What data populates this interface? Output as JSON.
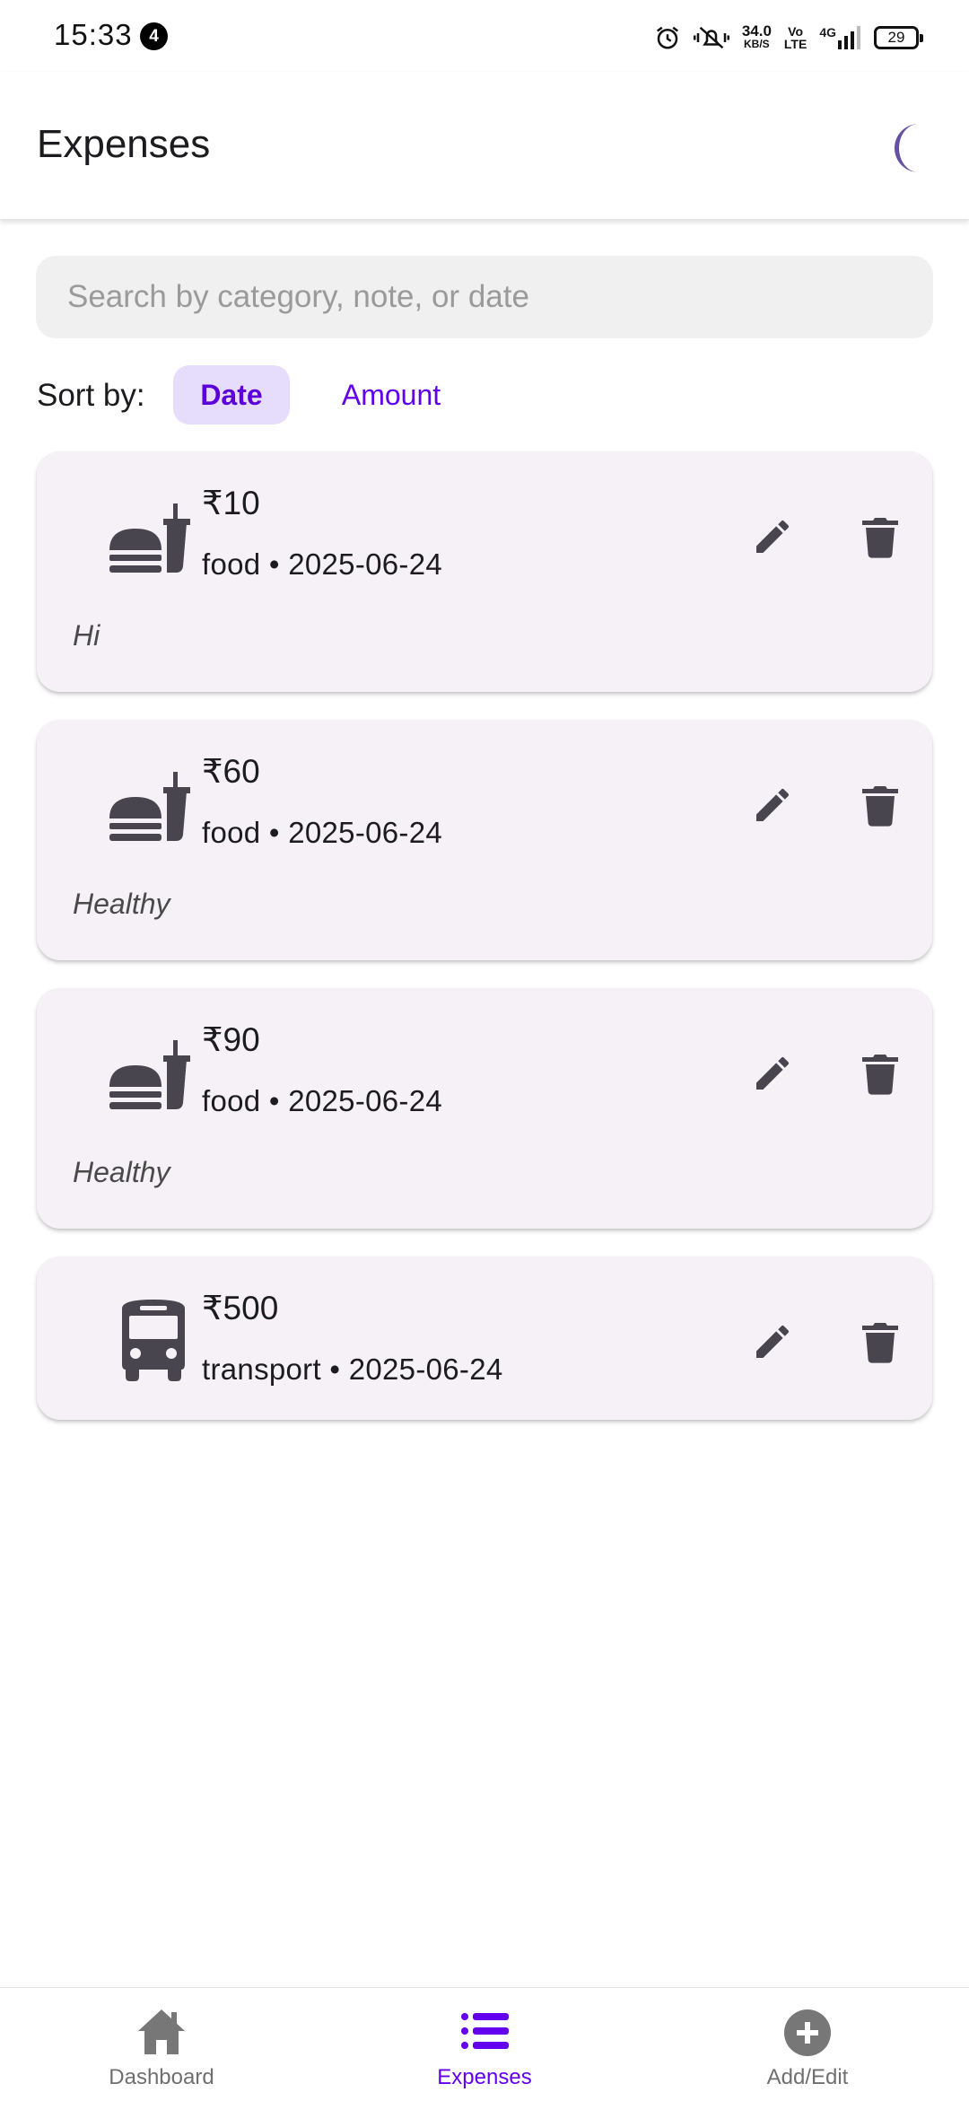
{
  "status_bar": {
    "time": "15:33",
    "notification_count": "4",
    "net_speed": "34.0",
    "net_unit": "KB/S",
    "volte_top": "Vo",
    "volte_bottom": "LTE",
    "network": "4G",
    "battery": "29"
  },
  "app_bar": {
    "title": "Expenses",
    "theme_icon": "moon-icon"
  },
  "search": {
    "placeholder": "Search by category, note, or date",
    "value": ""
  },
  "sort": {
    "label": "Sort by:",
    "options": [
      "Date",
      "Amount"
    ],
    "selected": "Date"
  },
  "expenses": [
    {
      "icon": "fastfood-icon",
      "amount": "₹10",
      "meta": "food • 2025-06-24",
      "note": "Hi"
    },
    {
      "icon": "fastfood-icon",
      "amount": "₹60",
      "meta": "food • 2025-06-24",
      "note": "Healthy"
    },
    {
      "icon": "fastfood-icon",
      "amount": "₹90",
      "meta": "food • 2025-06-24",
      "note": "Healthy"
    },
    {
      "icon": "bus-icon",
      "amount": "₹500",
      "meta": "transport • 2025-06-24",
      "note": ""
    }
  ],
  "bottom_nav": {
    "items": [
      {
        "label": "Dashboard",
        "icon": "home-icon"
      },
      {
        "label": "Expenses",
        "icon": "list-icon"
      },
      {
        "label": "Add/Edit",
        "icon": "add-circle-icon"
      }
    ],
    "active": "Expenses"
  },
  "colors": {
    "accent": "#6200ee",
    "chip_bg": "#e6dcfc",
    "card_bg": "#f5f1f7",
    "icon_dark": "#48454e",
    "moon": "#6750a4"
  }
}
